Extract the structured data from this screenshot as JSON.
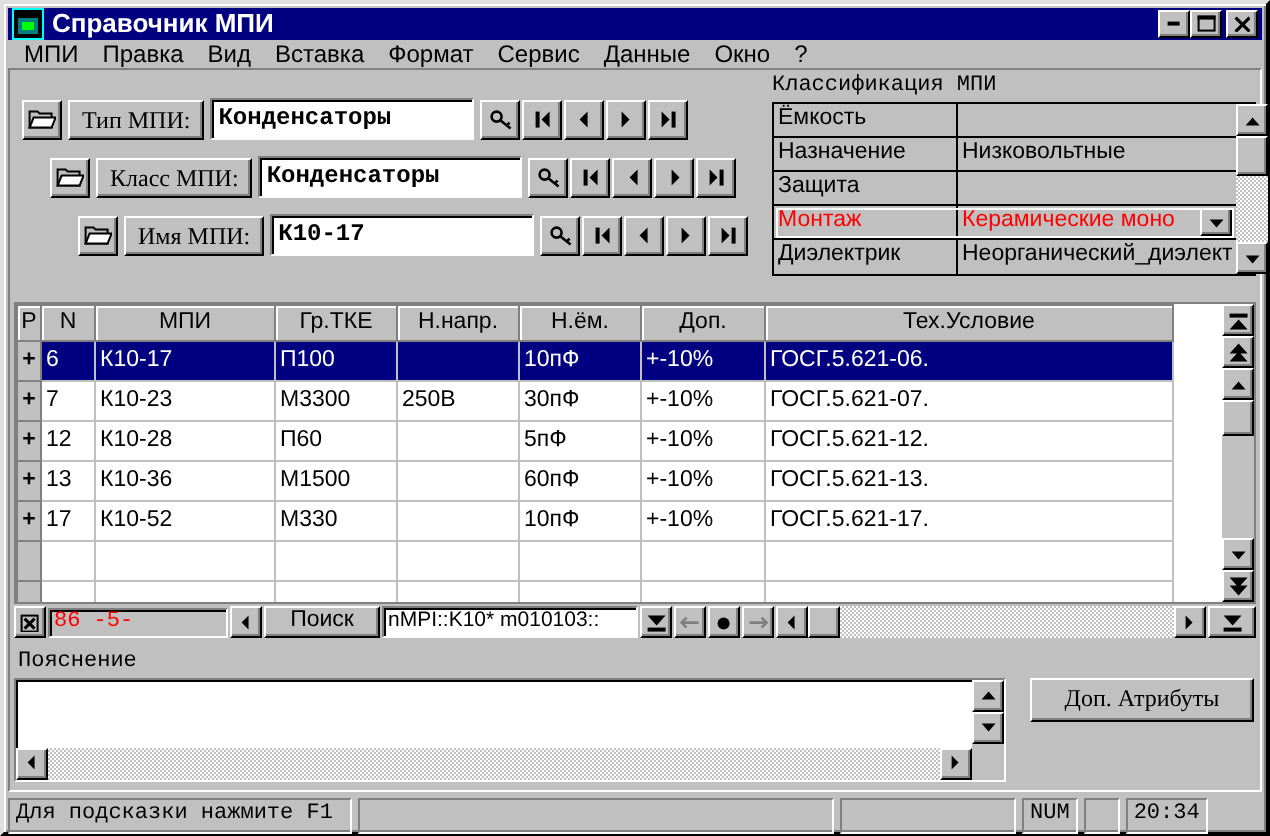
{
  "window": {
    "title": "Справочник МПИ"
  },
  "menu": [
    "МПИ",
    "Правка",
    "Вид",
    "Вставка",
    "Формат",
    "Сервис",
    "Данные",
    "Окно",
    "?"
  ],
  "lookups": [
    {
      "label": "Тип МПИ:",
      "value": "Конденсаторы"
    },
    {
      "label": "Класс МПИ:",
      "value": "Конденсаторы"
    },
    {
      "label": "Имя МПИ:",
      "value": "К10-17"
    }
  ],
  "classification": {
    "title": "Классификация МПИ",
    "rows": [
      {
        "name": "Ёмкость",
        "value": "",
        "selected": false
      },
      {
        "name": "Назначение",
        "value": "Низковольтные",
        "selected": false
      },
      {
        "name": "Защита",
        "value": "",
        "selected": false
      },
      {
        "name": "Монтаж",
        "value": "Керамические моно",
        "selected": true
      },
      {
        "name": "Диэлектрик",
        "value": "Неорганический_диэлект",
        "selected": false
      }
    ]
  },
  "table": {
    "columns": [
      "Р",
      "N",
      "МПИ",
      "Гр.ТКЕ",
      "Н.напр.",
      "Н.ём.",
      "Доп.",
      "Тех.Условие"
    ],
    "rows": [
      {
        "cells": [
          "+",
          "6",
          "К10-17",
          "П100",
          "",
          "10пФ",
          "+-10%",
          "ГОСГ.5.621-06."
        ],
        "selected": true
      },
      {
        "cells": [
          "+",
          "7",
          "К10-23",
          "М3300",
          "250В",
          "30пФ",
          "+-10%",
          "ГОСГ.5.621-07."
        ],
        "selected": false
      },
      {
        "cells": [
          "+",
          "12",
          "К10-28",
          "П60",
          "",
          "5пФ",
          "+-10%",
          "ГОСГ.5.621-12."
        ],
        "selected": false
      },
      {
        "cells": [
          "+",
          "13",
          "К10-36",
          "М1500",
          "",
          "60пФ",
          "+-10%",
          "ГОСГ.5.621-13."
        ],
        "selected": false
      },
      {
        "cells": [
          "+",
          "17",
          "К10-52",
          "М330",
          "",
          "10пФ",
          "+-10%",
          "ГОСГ.5.621-17."
        ],
        "selected": false
      }
    ]
  },
  "record_bar": {
    "counter": "86 -5-",
    "search_button": "Поиск",
    "filter": "nMPI::K10*  m010103::"
  },
  "note": {
    "label": "Пояснение"
  },
  "attributes_button": "Доп. Атрибуты",
  "status_bar": {
    "hint": "Для подсказки нажмите F1",
    "num": "NUM",
    "time": "20:34"
  }
}
